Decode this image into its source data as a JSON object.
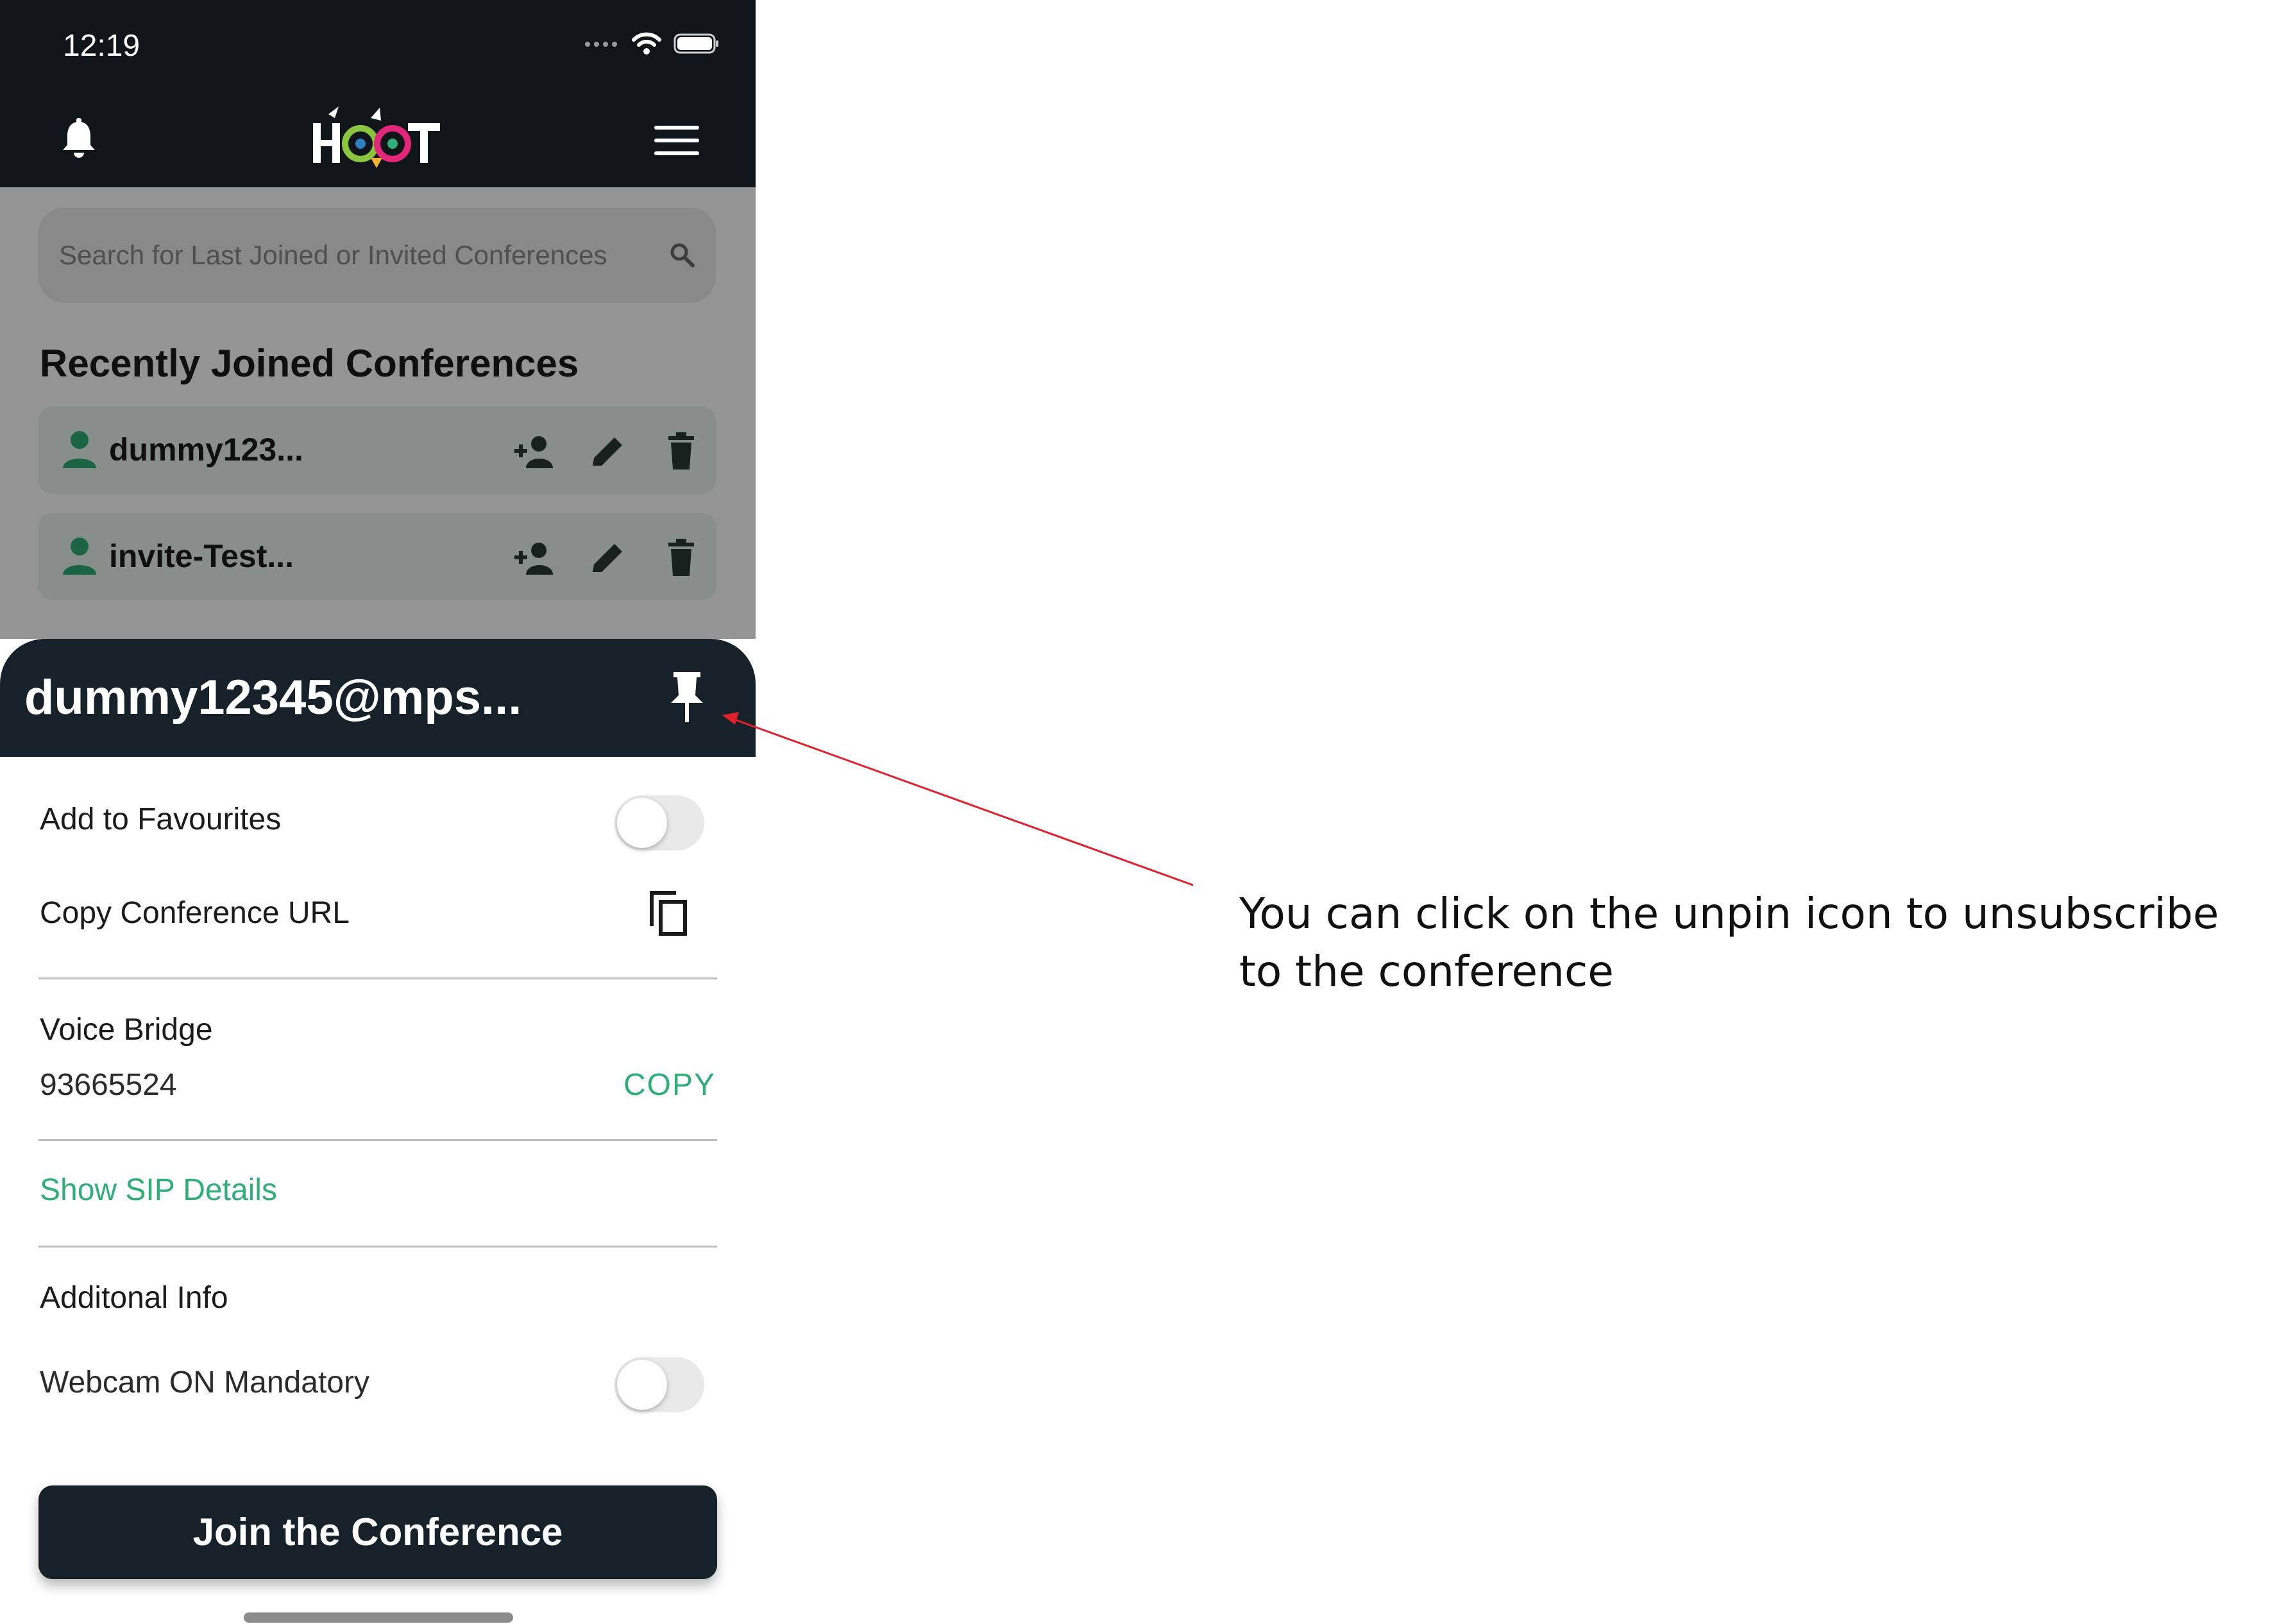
{
  "status_bar": {
    "time": "12:19"
  },
  "navbar": {
    "logo_text": "HOOT"
  },
  "search": {
    "placeholder": "Search for Last Joined or Invited Conferences"
  },
  "recent": {
    "title": "Recently Joined Conferences",
    "items": [
      {
        "name": "dummy123..."
      },
      {
        "name": "invite-Test..."
      }
    ]
  },
  "sheet": {
    "title": "dummy12345@mps...",
    "favourites_label": "Add to Favourites",
    "favourites_on": false,
    "copy_url_label": "Copy Conference URL",
    "voice_bridge_label": "Voice Bridge",
    "voice_bridge_number": "93665524",
    "copy_label": "COPY",
    "sip_link": "Show SIP Details",
    "additional_info_label": "Additonal Info",
    "webcam_label": "Webcam ON Mandatory",
    "webcam_on": false,
    "join_button": "Join the Conference"
  },
  "annotation": {
    "text": "You can click on the unpin icon to unsubscribe to the conference",
    "arrow_color": "#e0202a"
  },
  "colors": {
    "dark": "#172129",
    "accent_green": "#2fae77"
  }
}
